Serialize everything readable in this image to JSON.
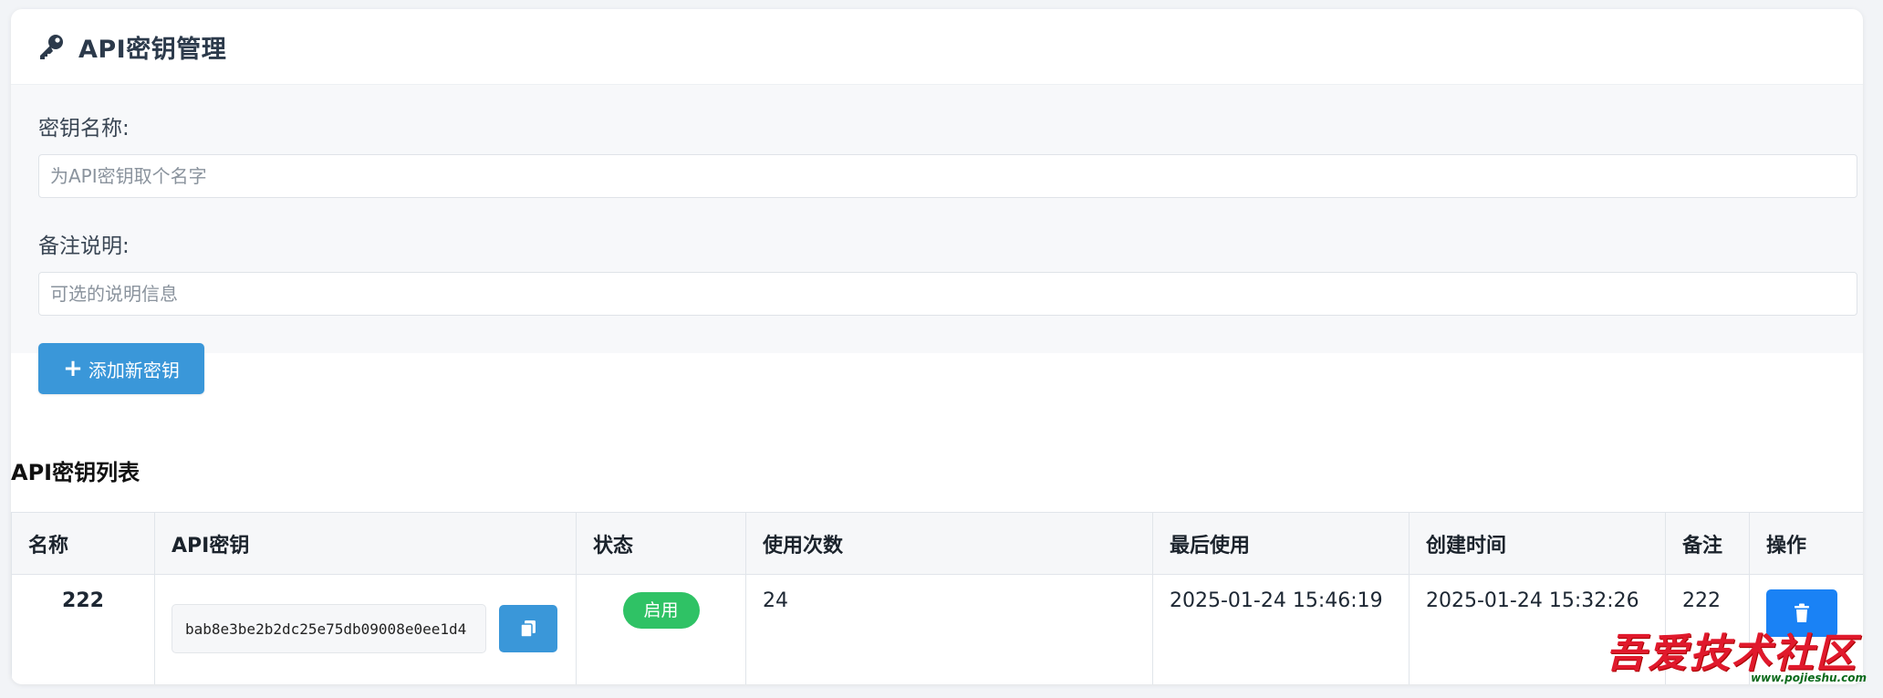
{
  "header": {
    "title": "API密钥管理",
    "icon": "key-icon"
  },
  "form": {
    "name_label": "密钥名称:",
    "name_placeholder": "为API密钥取个名字",
    "note_label": "备注说明:",
    "note_placeholder": "可选的说明信息",
    "add_button_label": "添加新密钥"
  },
  "list": {
    "title": "API密钥列表",
    "columns": [
      "名称",
      "API密钥",
      "状态",
      "使用次数",
      "最后使用",
      "创建时间",
      "备注",
      "操作"
    ],
    "rows": [
      {
        "name": "222",
        "api_key": "bab8e3be2b2dc25e75db09008e0ee1d4",
        "status": "启用",
        "usage_count": "24",
        "last_used": "2025-01-24 15:46:19",
        "created_at": "2025-01-24 15:32:26",
        "note": "222"
      }
    ]
  },
  "colors": {
    "primary_button": "#3a97d9",
    "status_enabled": "#2fc265",
    "delete_button": "#1a82f5"
  },
  "watermark": {
    "text": "吾爱技术社区",
    "url": "www.pojieshu.com"
  }
}
